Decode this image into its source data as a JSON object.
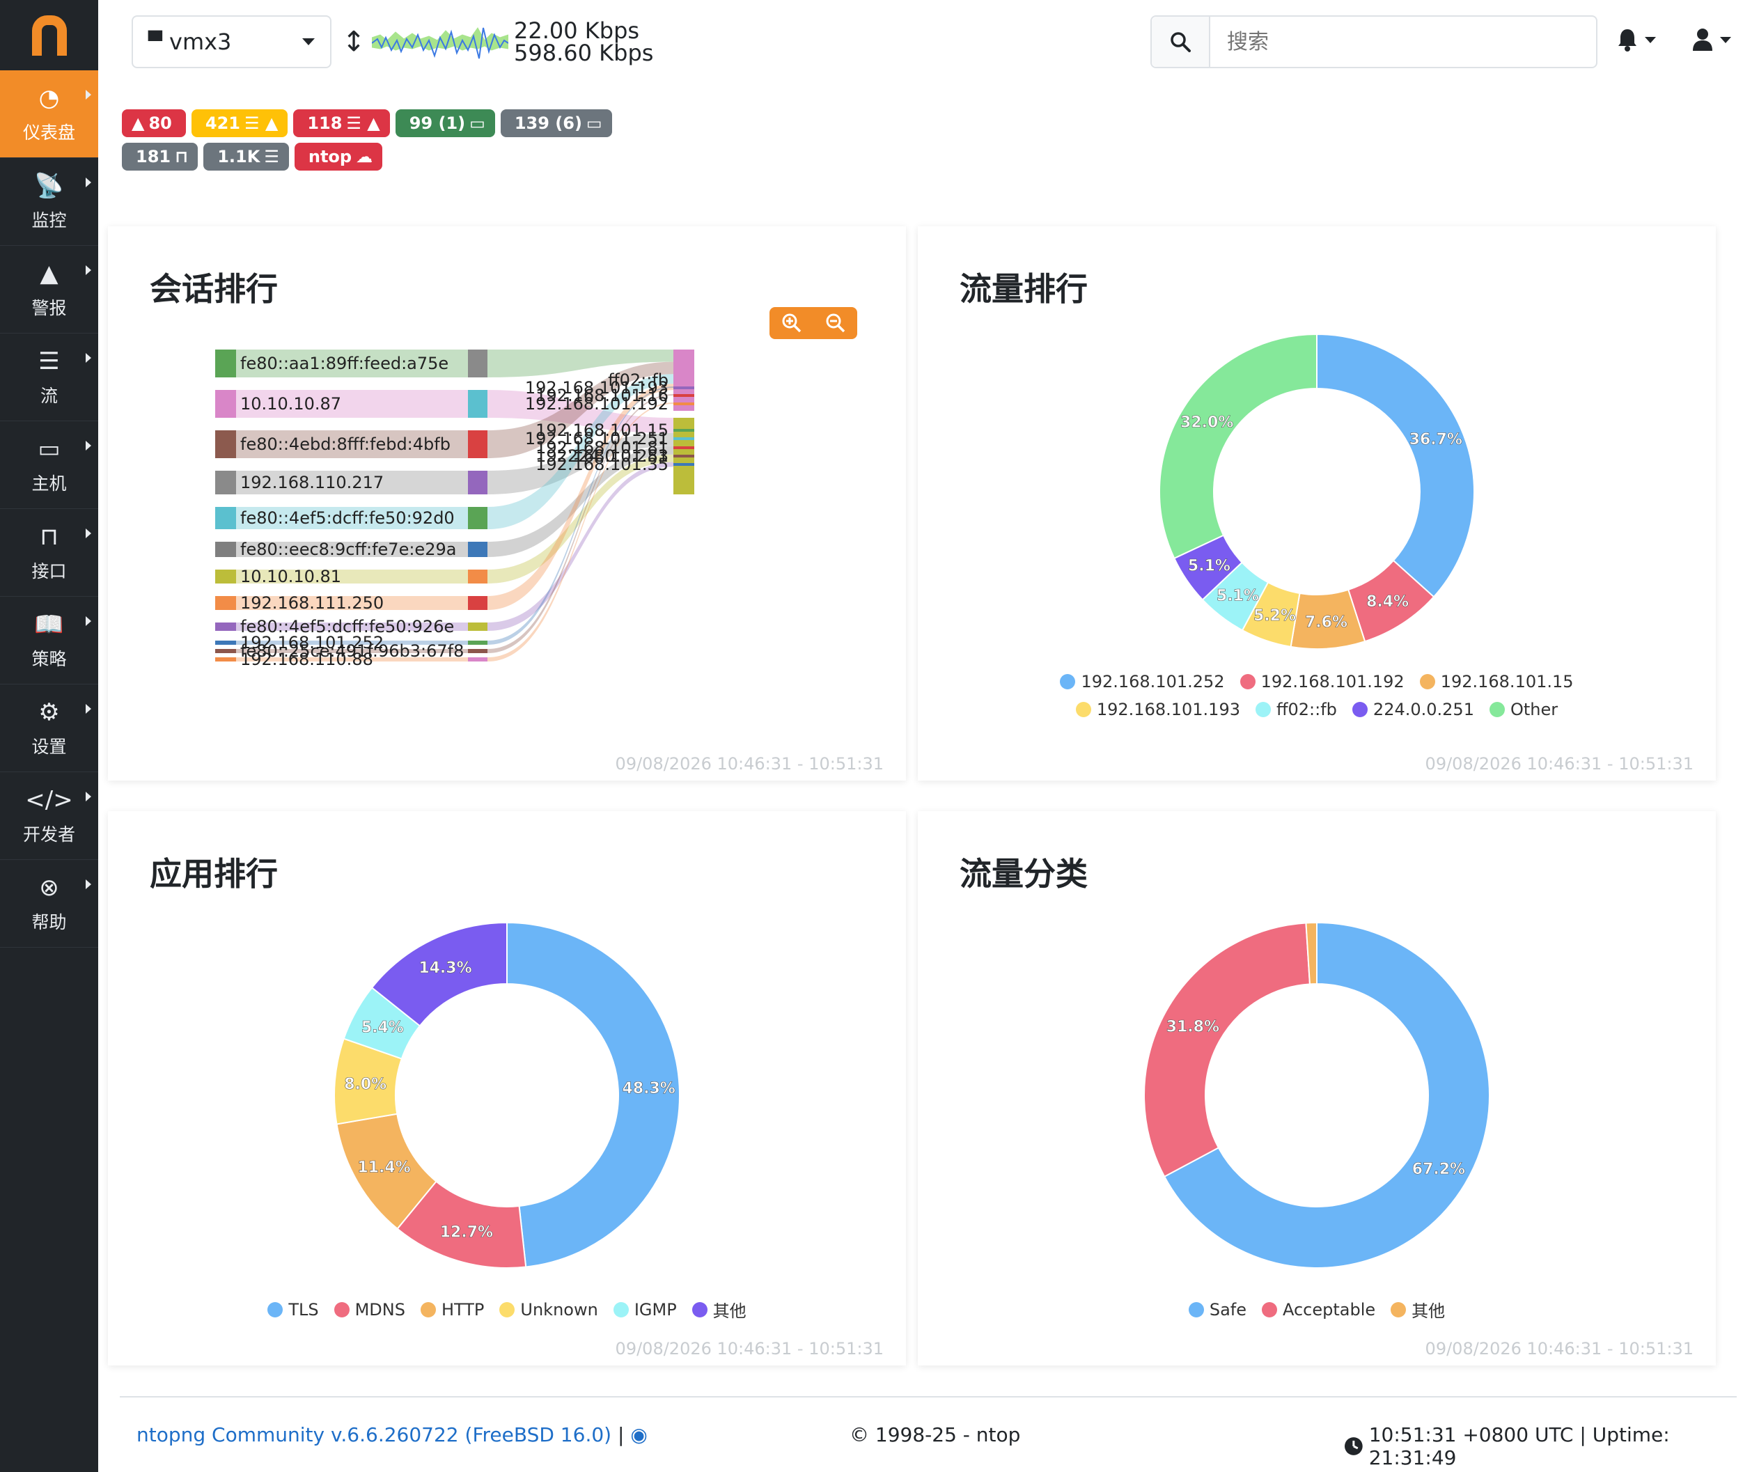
{
  "sidebar": {
    "items": [
      {
        "label": "仪表盘",
        "icon": "gauge-icon",
        "glyph": "◔",
        "active": true
      },
      {
        "label": "监控",
        "icon": "satellite-dish-icon",
        "glyph": "📡",
        "active": false
      },
      {
        "label": "警报",
        "icon": "warning-icon",
        "glyph": "▲",
        "active": false
      },
      {
        "label": "流",
        "icon": "stream-icon",
        "glyph": "☰",
        "active": false
      },
      {
        "label": "主机",
        "icon": "laptop-icon",
        "glyph": "▭",
        "active": false
      },
      {
        "label": "接口",
        "icon": "ethernet-icon",
        "glyph": "⊓",
        "active": false
      },
      {
        "label": "策略",
        "icon": "book-icon",
        "glyph": "📖",
        "active": false
      },
      {
        "label": "设置",
        "icon": "gear-icon",
        "glyph": "⚙",
        "active": false
      },
      {
        "label": "开发者",
        "icon": "code-icon",
        "glyph": "</>",
        "active": false
      },
      {
        "label": "帮助",
        "icon": "life-ring-icon",
        "glyph": "⊗",
        "active": false
      }
    ]
  },
  "header": {
    "interface": "vmx3",
    "rate_up": "22.00 Kbps",
    "rate_down": "598.60 Kbps",
    "search_placeholder": "搜索"
  },
  "badges": [
    {
      "text": "80",
      "prefix": "▲",
      "suffix": "",
      "color": "#dc3545"
    },
    {
      "text": "421",
      "prefix": "",
      "suffix": "☰ ▲",
      "color": "#ffc107"
    },
    {
      "text": "118",
      "prefix": "",
      "suffix": "☰ ▲",
      "color": "#dc3545"
    },
    {
      "text": "99 (1)",
      "prefix": "",
      "suffix": "▭",
      "color": "#3d8a55"
    },
    {
      "text": "139 (6)",
      "prefix": "",
      "suffix": "▭",
      "color": "#6c757d"
    },
    {
      "text": "181",
      "prefix": "",
      "suffix": "⊓",
      "color": "#6c757d"
    },
    {
      "text": "1.1K",
      "prefix": "",
      "suffix": "☰",
      "color": "#6c757d"
    },
    {
      "text": "ntop",
      "prefix": "",
      "suffix": "☁",
      "color": "#dc3545"
    }
  ],
  "cards": {
    "sessions": {
      "title": "会话排行",
      "time": "09/08/2026 10:46:31 - 10:51:31"
    },
    "traffic": {
      "title": "流量排行",
      "time": "09/08/2026 10:46:31 - 10:51:31"
    },
    "apps": {
      "title": "应用排行",
      "time": "09/08/2026 10:46:31 - 10:51:31"
    },
    "categories": {
      "title": "流量分类",
      "time": "09/08/2026 10:46:31 - 10:51:31"
    }
  },
  "chart_data": [
    {
      "type": "sankey",
      "sources": [
        "fe80::aa1:89ff:feed:a75e",
        "10.10.10.87",
        "fe80::4ebd:8fff:febd:4bfb",
        "192.168.110.217",
        "fe80::4ef5:dcff:fe50:92d0",
        "fe80::eec8:9cff:fe7e:e29a",
        "10.10.10.81",
        "192.168.111.250",
        "fe80::4ef5:dcff:fe50:926e",
        "192.168.101.252",
        "fe80::25ce:491f:96b3:67f8",
        "192.168.110.88"
      ],
      "source_colors": [
        "#5aa455",
        "#d986c8",
        "#8c5a4e",
        "#8a8a8a",
        "#5bc0cf",
        "#7f7f7f",
        "#bcbd3a",
        "#f28c47",
        "#9467bd",
        "#3d78b8",
        "#8c564b",
        "#f28c47"
      ],
      "mid_colors": [
        "#8a8a8a",
        "#5bc0cf",
        "#d94141",
        "#9467bd",
        "#5aa455",
        "#3d78b8",
        "#f28c47",
        "#d94141",
        "#bcbd3a",
        "#5aa455",
        "#8c564b",
        "#d986c8"
      ],
      "targets": [
        "ff02::fb",
        "224.0.0.251",
        "192.168.101.193",
        "192.168.101.16",
        "192.168.101.192",
        "192.168.101.15",
        "192.168.101.251",
        "192.168.101.81",
        "192.168.101.83",
        "192.168.101.35"
      ],
      "target_colors": [
        "#d986c8",
        "#bcbd3a",
        "#9467bd",
        "#d94141",
        "#f28c47",
        "#5aa455",
        "#5bc0cf",
        "#d94141",
        "#8c564b",
        "#3d78b8"
      ]
    },
    {
      "type": "pie",
      "title": "流量排行",
      "labels": [
        "192.168.101.252",
        "192.168.101.192",
        "192.168.101.15",
        "192.168.101.193",
        "ff02::fb",
        "224.0.0.251",
        "Other"
      ],
      "values": [
        36.7,
        8.4,
        7.6,
        5.2,
        5.1,
        5.1,
        32.0
      ],
      "colors": [
        "#6bb5f7",
        "#ef6c7f",
        "#f4b45f",
        "#fcdc6b",
        "#9cf3f7",
        "#7a5cf0",
        "#85e89a"
      ]
    },
    {
      "type": "pie",
      "title": "应用排行",
      "labels": [
        "TLS",
        "MDNS",
        "HTTP",
        "Unknown",
        "IGMP",
        "其他"
      ],
      "values": [
        48.3,
        12.7,
        11.4,
        8.0,
        5.4,
        14.3
      ],
      "colors": [
        "#6bb5f7",
        "#ef6c7f",
        "#f4b45f",
        "#fcdc6b",
        "#9cf3f7",
        "#7a5cf0"
      ]
    },
    {
      "type": "pie",
      "title": "流量分类",
      "labels": [
        "Safe",
        "Acceptable",
        "其他"
      ],
      "values": [
        67.2,
        31.8,
        1.0
      ],
      "colors": [
        "#6bb5f7",
        "#ef6c7f",
        "#f4b45f"
      ]
    }
  ],
  "footer": {
    "version": "ntopng Community v.6.6.260722 (FreeBSD 16.0)",
    "separator": "|",
    "copyright": "© 1998-25 - ntop",
    "uptime": "10:51:31 +0800 UTC | Uptime: 21:31:49",
    "link_color": "#1e6ec8"
  }
}
